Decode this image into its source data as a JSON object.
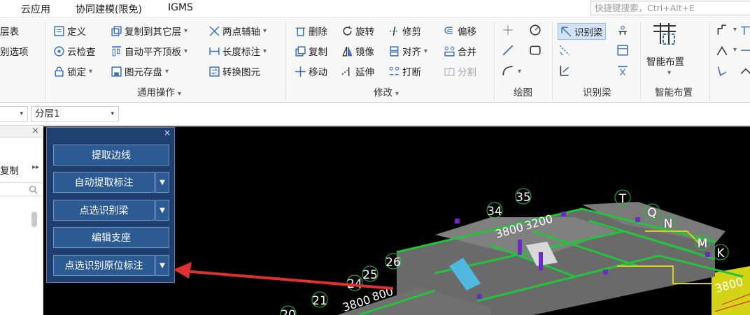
{
  "menubar": {
    "items": [
      "云应用",
      "协同建模(限免)",
      "IGMS"
    ],
    "search_placeholder": "快捷键搜索，Ctrl+Alt+E"
  },
  "ribbon": {
    "left_partial": [
      "层表",
      "别选项"
    ],
    "common_ops": {
      "label": "通用操作",
      "buttons": [
        "定义",
        "复制到其它层",
        "两点辅轴",
        "云检查",
        "自动平齐顶板",
        "长度标注",
        "锁定",
        "图元存盘",
        "转换图元"
      ]
    },
    "modify": {
      "label": "修改",
      "buttons": [
        "删除",
        "旋转",
        "修剪",
        "偏移",
        "复制",
        "镜像",
        "对齐",
        "合并",
        "移动",
        "延伸",
        "打断",
        "分割"
      ]
    },
    "draw": {
      "label": "绘图"
    },
    "identify_beam": {
      "label": "识别梁",
      "button": "识别梁"
    },
    "smart_layout": {
      "label": "智能布置",
      "button": "智能布置"
    }
  },
  "selectors": {
    "layer": "分层1"
  },
  "left_panel": {
    "copy_label": "复制"
  },
  "float_panel": {
    "buttons": [
      "提取边线",
      "自动提取标注",
      "点选识别梁",
      "编辑支座",
      "点选识别原位标注"
    ]
  },
  "canvas": {
    "axis_labels": [
      "35",
      "34",
      "T",
      "Q",
      "N",
      "M",
      "K",
      "26",
      "25",
      "24",
      "21",
      "20"
    ],
    "dimension_labels": [
      "3800",
      "3200",
      "3800",
      "800",
      "3800"
    ]
  },
  "colors": {
    "panel_bg": "#1f3f6e",
    "panel_button": "#2c5a93",
    "arrow": "#e03030",
    "beam_green": "#22c43a",
    "wall_yellow": "#d4d417",
    "column_purple": "#6a2cc4"
  }
}
